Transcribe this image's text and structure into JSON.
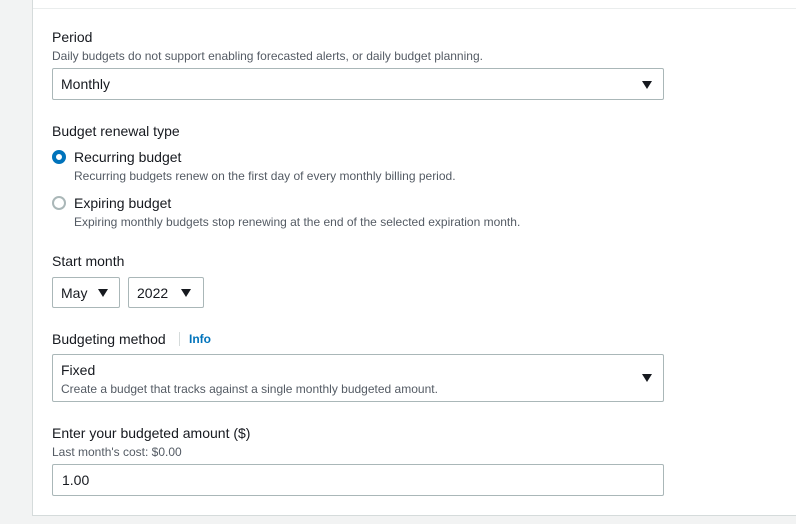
{
  "period": {
    "label": "Period",
    "description": "Daily budgets do not support enabling forecasted alerts, or daily budget planning.",
    "selected": "Monthly"
  },
  "renewal": {
    "label": "Budget renewal type",
    "options": [
      {
        "label": "Recurring budget",
        "description": "Recurring budgets renew on the first day of every monthly billing period.",
        "checked": true
      },
      {
        "label": "Expiring budget",
        "description": "Expiring monthly budgets stop renewing at the end of the selected expiration month.",
        "checked": false
      }
    ]
  },
  "start_month": {
    "label": "Start month",
    "month": "May",
    "year": "2022"
  },
  "method": {
    "label": "Budgeting method",
    "info_link": "Info",
    "selected": "Fixed",
    "selected_description": "Create a budget that tracks against a single monthly budgeted amount."
  },
  "amount": {
    "label": "Enter your budgeted amount ($)",
    "description": "Last month's cost: $0.00",
    "value": "1.00"
  },
  "colors": {
    "accent": "#0073bb",
    "border": "#aab7b8",
    "text": "#16191f",
    "muted": "#545b64"
  }
}
